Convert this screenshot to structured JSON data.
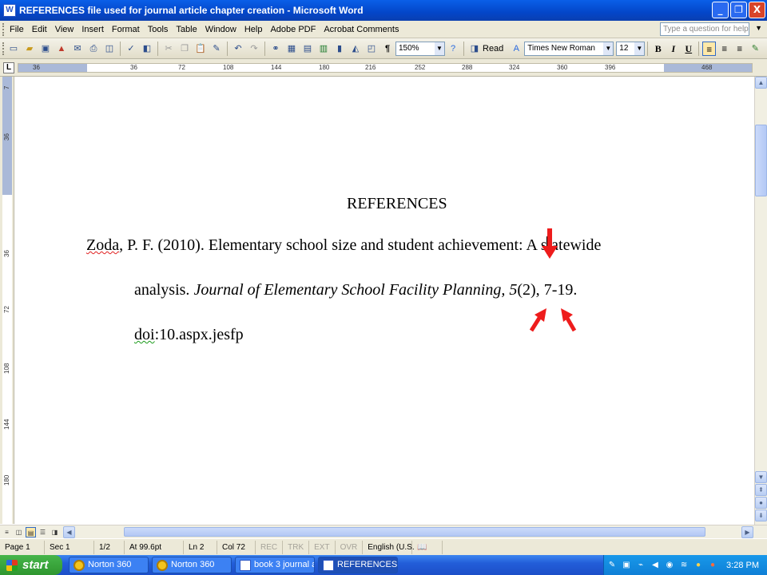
{
  "window": {
    "title": "REFERENCES file used for journal article chapter creation - Microsoft Word",
    "minimize": "_",
    "maximize": "❐",
    "close": "X"
  },
  "menu": {
    "items": [
      "File",
      "Edit",
      "View",
      "Insert",
      "Format",
      "Tools",
      "Table",
      "Window",
      "Help",
      "Adobe PDF",
      "Acrobat Comments"
    ],
    "help_placeholder": "Type a question for help"
  },
  "toolbar": {
    "zoom": "150%",
    "read_label": "Read",
    "font_name": "Times New Roman",
    "font_size": "12",
    "bold": "B",
    "italic": "I",
    "underline": "U"
  },
  "ruler": {
    "ticks": [
      "36",
      "36",
      "72",
      "108",
      "144",
      "180",
      "216",
      "252",
      "288",
      "324",
      "360",
      "396",
      "468"
    ],
    "vticks": [
      "7",
      "36",
      "36",
      "72",
      "108",
      "144",
      "180"
    ]
  },
  "document": {
    "heading": "REFERENCES",
    "line1_author": "Zoda",
    "line1_rest": ", P. F. (2010). Elementary school size and student achievement: A statewide",
    "line2_plain": "analysis. ",
    "line2_italic_journal": "Journal of Elementary School Facility Planning, 5",
    "line2_issue": "(2), ",
    "line2_pages": "7-19",
    "line2_end": ".",
    "line3_doi_prefix": "doi",
    "line3_rest": ":10.aspx.jesfp",
    "annotation_color": "#ee1c1c"
  },
  "status": {
    "page": "Page 1",
    "section": "Sec 1",
    "pages_of": "1/2",
    "at": "At 99.6pt",
    "line": "Ln 2",
    "col": "Col 72",
    "rec": "REC",
    "trk": "TRK",
    "ext": "EXT",
    "ovr": "OVR",
    "language": "English (U.S."
  },
  "taskbar": {
    "start": "start",
    "tasks": [
      "Norton 360",
      "Norton 360",
      "book 3 journal a...",
      "REFERENCES fil..."
    ],
    "clock": "3:28 PM"
  }
}
